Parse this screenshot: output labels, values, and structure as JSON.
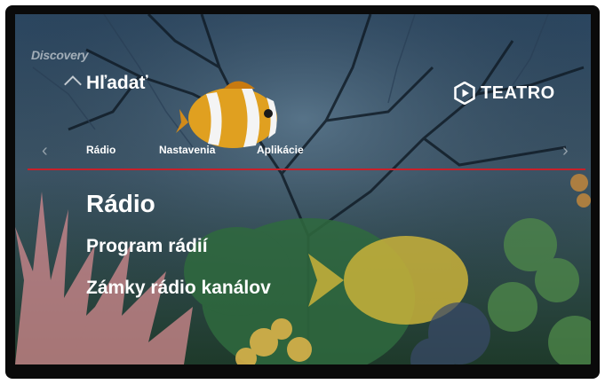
{
  "watermark": "Discovery",
  "header": {
    "title": "Hľadať",
    "up_icon": "chevron-up-icon",
    "brand": "TEATRO",
    "brand_icon": "play-hexagon-icon"
  },
  "tabs": [
    {
      "label": "Rádio"
    },
    {
      "label": "Nastavenia"
    },
    {
      "label": "Aplikácie"
    }
  ],
  "menu": [
    {
      "label": "Rádio",
      "selected": true
    },
    {
      "label": "Program rádií",
      "selected": false
    },
    {
      "label": "Zámky rádio kanálov",
      "selected": false
    }
  ],
  "colors": {
    "accent": "#c8202a",
    "text": "#ffffff"
  }
}
